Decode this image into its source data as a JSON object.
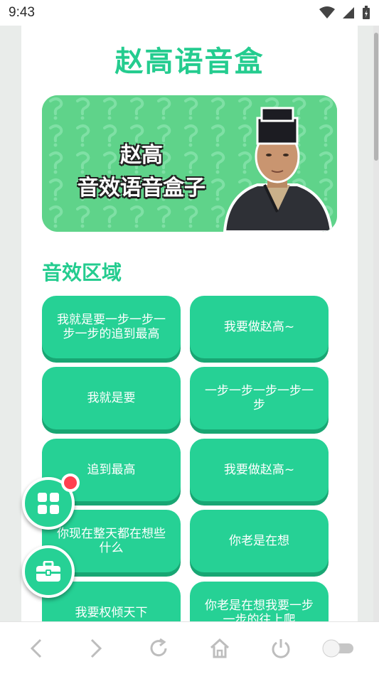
{
  "status_bar": {
    "time": "9:43"
  },
  "app": {
    "title": "赵高语音盒"
  },
  "banner": {
    "line1": "赵高",
    "line2": "音效语音盒子"
  },
  "section": {
    "title": "音效区域"
  },
  "sounds": [
    {
      "label": "我就是要一步一步一步一步的追到最高"
    },
    {
      "label": "我要做赵高~"
    },
    {
      "label": "我就是要"
    },
    {
      "label": "一步一步一步一步一步"
    },
    {
      "label": "追到最高"
    },
    {
      "label": "我要做赵高~"
    },
    {
      "label": "你现在整天都在想些什么"
    },
    {
      "label": "你老是在想"
    },
    {
      "label": "我要权倾天下"
    },
    {
      "label": "你老是在想我要一步一步的往上爬"
    }
  ],
  "fabs": {
    "apps_icon": "grid-icon",
    "tools_icon": "toolbox-icon"
  },
  "colors": {
    "accent": "#26d195",
    "accent_dark": "#18a673",
    "badge": "#ff4050"
  }
}
